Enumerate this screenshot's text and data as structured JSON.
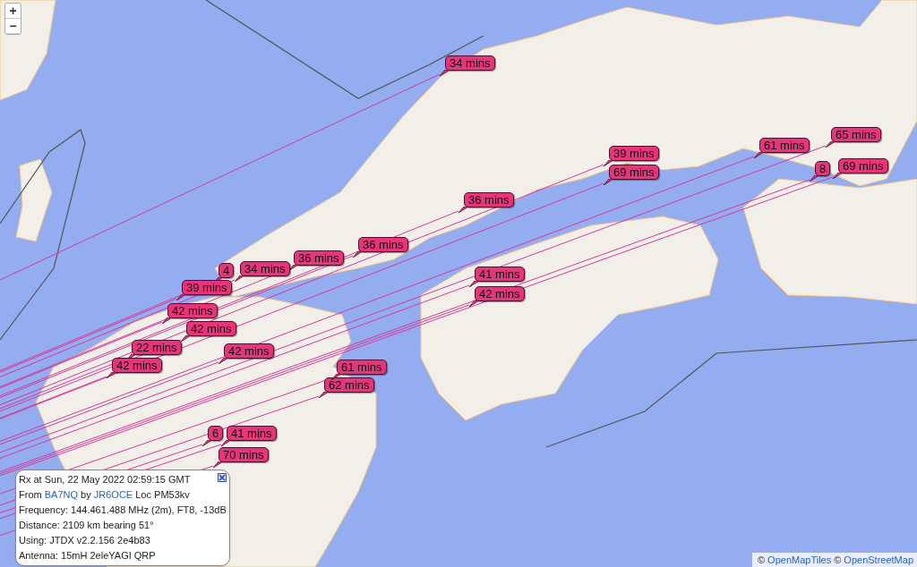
{
  "zoom_controls": [
    {
      "label": "+"
    },
    {
      "label": "−"
    }
  ],
  "markers": [
    {
      "label": "34 mins"
    },
    {
      "label": "39 mins"
    },
    {
      "label": "69 mins"
    },
    {
      "label": "61 mins"
    },
    {
      "label": "65 mins"
    },
    {
      "label": "8"
    },
    {
      "label": "69 mins"
    },
    {
      "label": "36 mins"
    },
    {
      "label": "36 mins"
    },
    {
      "label": "36 mins"
    },
    {
      "label": "4"
    },
    {
      "label": "34 mins"
    },
    {
      "label": "39 mins"
    },
    {
      "label": "42 mins"
    },
    {
      "label": "42 mins"
    },
    {
      "label": "22 mins"
    },
    {
      "label": "42 mins"
    },
    {
      "label": "42 mins"
    },
    {
      "label": "41 mins"
    },
    {
      "label": "42 mins"
    },
    {
      "label": "62 mins"
    },
    {
      "label": "61 mins"
    },
    {
      "label": "6"
    },
    {
      "label": "41 mins"
    },
    {
      "label": "70 mins"
    }
  ],
  "popup": {
    "heading": "Rx at Sun, 22 May 2022 02:59:15 GMT",
    "from": {
      "prefix": "From",
      "sender": "BA7NQ",
      "joiner": "by",
      "receiver": "JR6OCE",
      "suffix": "Loc PM53kv"
    },
    "details": [
      "Frequency: 144.461.488 MHz (2m), FT8, -13dB",
      "Distance: 2109 km bearing 51°",
      "Using: JTDX v2.2.156 2e4b83",
      "Antenna: 15mH 2eleYAGI QRP"
    ]
  },
  "attribution": [
    {
      "symbol": "©",
      "link": "OpenMapTiles"
    },
    {
      "symbol": "©",
      "link": "OpenStreetMap"
    }
  ]
}
